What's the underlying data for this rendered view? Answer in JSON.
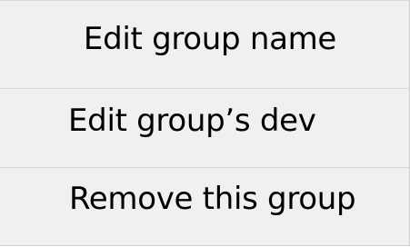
{
  "context_menu": {
    "items": [
      {
        "label": "Edit group name"
      },
      {
        "label": "Edit group’s dev"
      },
      {
        "label": "Remove this group"
      }
    ]
  }
}
